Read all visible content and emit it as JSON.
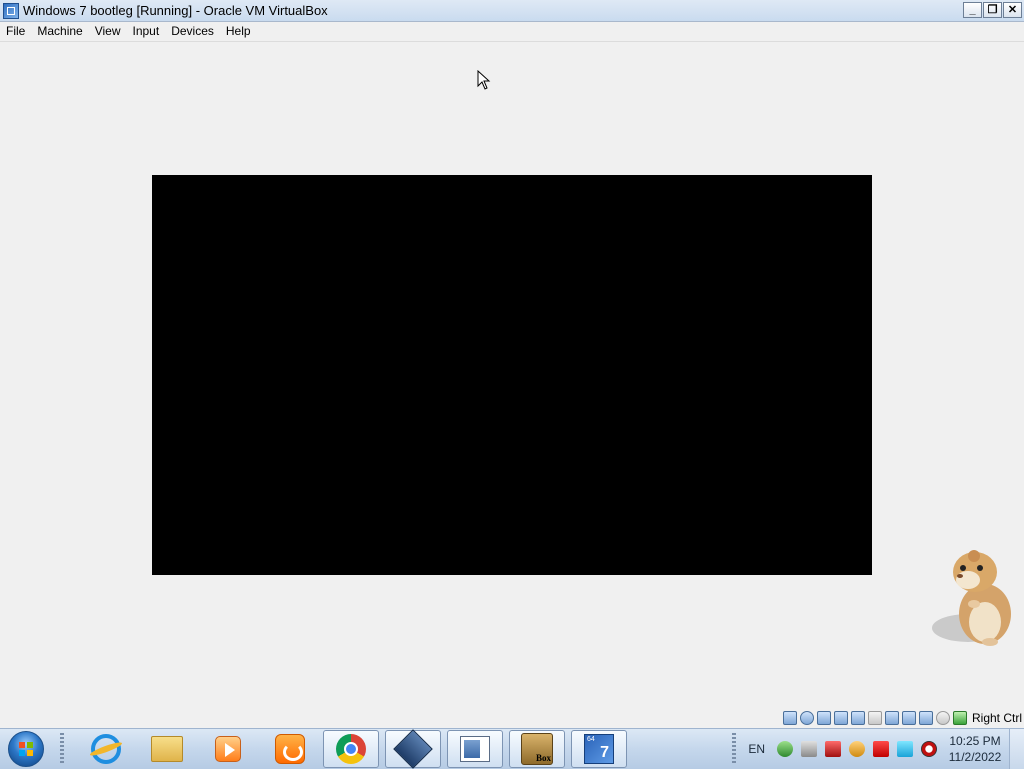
{
  "window": {
    "title": "Windows 7 bootleg [Running] - Oracle VM VirtualBox",
    "controls": {
      "minimize": "_",
      "restore": "❐",
      "close": "✕"
    }
  },
  "menu": [
    "File",
    "Machine",
    "View",
    "Input",
    "Devices",
    "Help"
  ],
  "vm_statusbar": {
    "icons": [
      "hard-disk-icon",
      "optical-drive-icon",
      "audio-icon",
      "network-icon",
      "usb-icon",
      "shared-folders-icon",
      "display-icon",
      "recording-icon",
      "cpu-icon",
      "mouse-integration-icon",
      "keyboard-icon"
    ],
    "host_key": "Right Ctrl"
  },
  "taskbar": {
    "pinned": [
      "internet-explorer-icon",
      "windows-explorer-icon",
      "media-player-icon",
      "uc-browser-icon",
      "chrome-icon",
      "virtualbox-icon",
      "document-viewer-icon",
      "virtualbox-box-icon",
      "windows7-installer-icon"
    ],
    "box_label": "Box",
    "win7_badge": "64",
    "win7_number": "7",
    "tray": {
      "language": "EN",
      "time": "10:25 PM",
      "date": "11/2/2022"
    }
  }
}
